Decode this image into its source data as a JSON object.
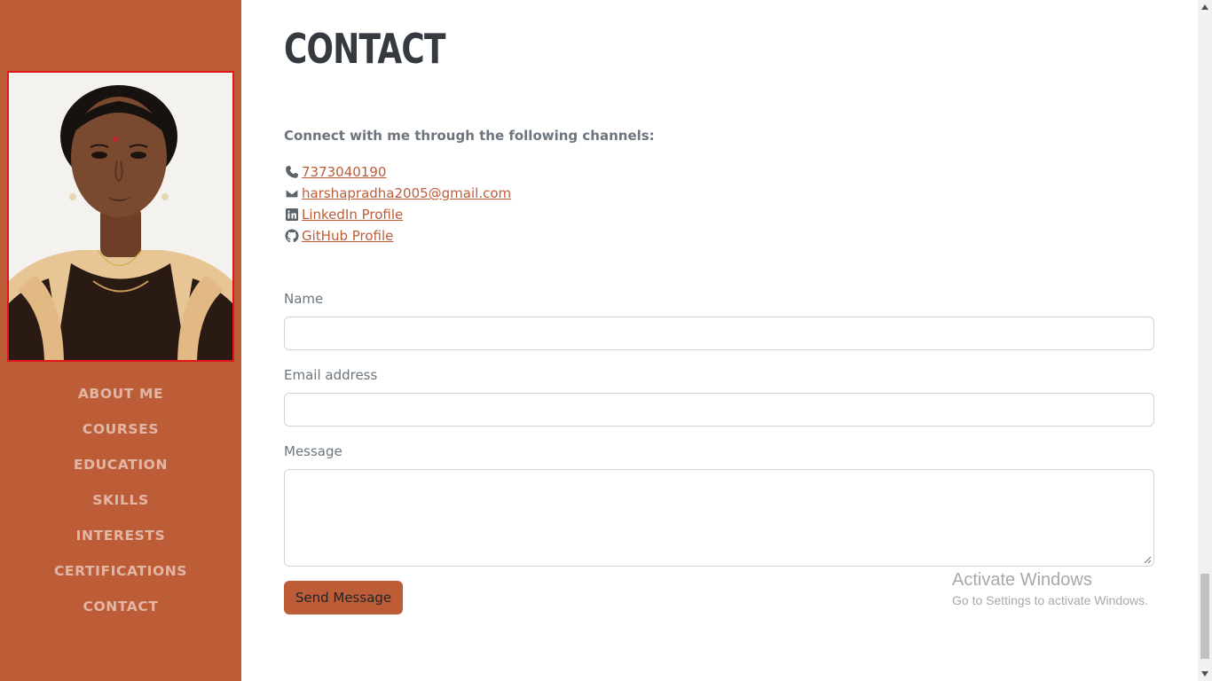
{
  "sidebar": {
    "photo_alt": "profile photo",
    "nav": [
      {
        "label": "ABOUT ME"
      },
      {
        "label": "COURSES"
      },
      {
        "label": "EDUCATION"
      },
      {
        "label": "SKILLS"
      },
      {
        "label": "INTERESTS"
      },
      {
        "label": "CERTIFICATIONS"
      },
      {
        "label": "CONTACT"
      }
    ]
  },
  "contact": {
    "title": "CONTACT",
    "intro": "Connect with me through the following channels:",
    "channels": [
      {
        "icon": "phone-icon",
        "text": "7373040190"
      },
      {
        "icon": "envelope-icon",
        "text": "harshapradha2005@gmail.com"
      },
      {
        "icon": "linkedin-icon",
        "text": "LinkedIn Profile"
      },
      {
        "icon": "github-icon",
        "text": "GitHub Profile"
      }
    ],
    "form": {
      "name_label": "Name",
      "name_value": "",
      "email_label": "Email address",
      "email_value": "",
      "message_label": "Message",
      "message_value": "",
      "submit_label": "Send Message"
    }
  },
  "watermark": {
    "title": "Activate Windows",
    "subtitle": "Go to Settings to activate Windows."
  },
  "colors": {
    "sidebar_bg": "#bd5d38",
    "accent": "#bd5d38",
    "heading": "#343a40",
    "muted_text": "#6c757d"
  }
}
